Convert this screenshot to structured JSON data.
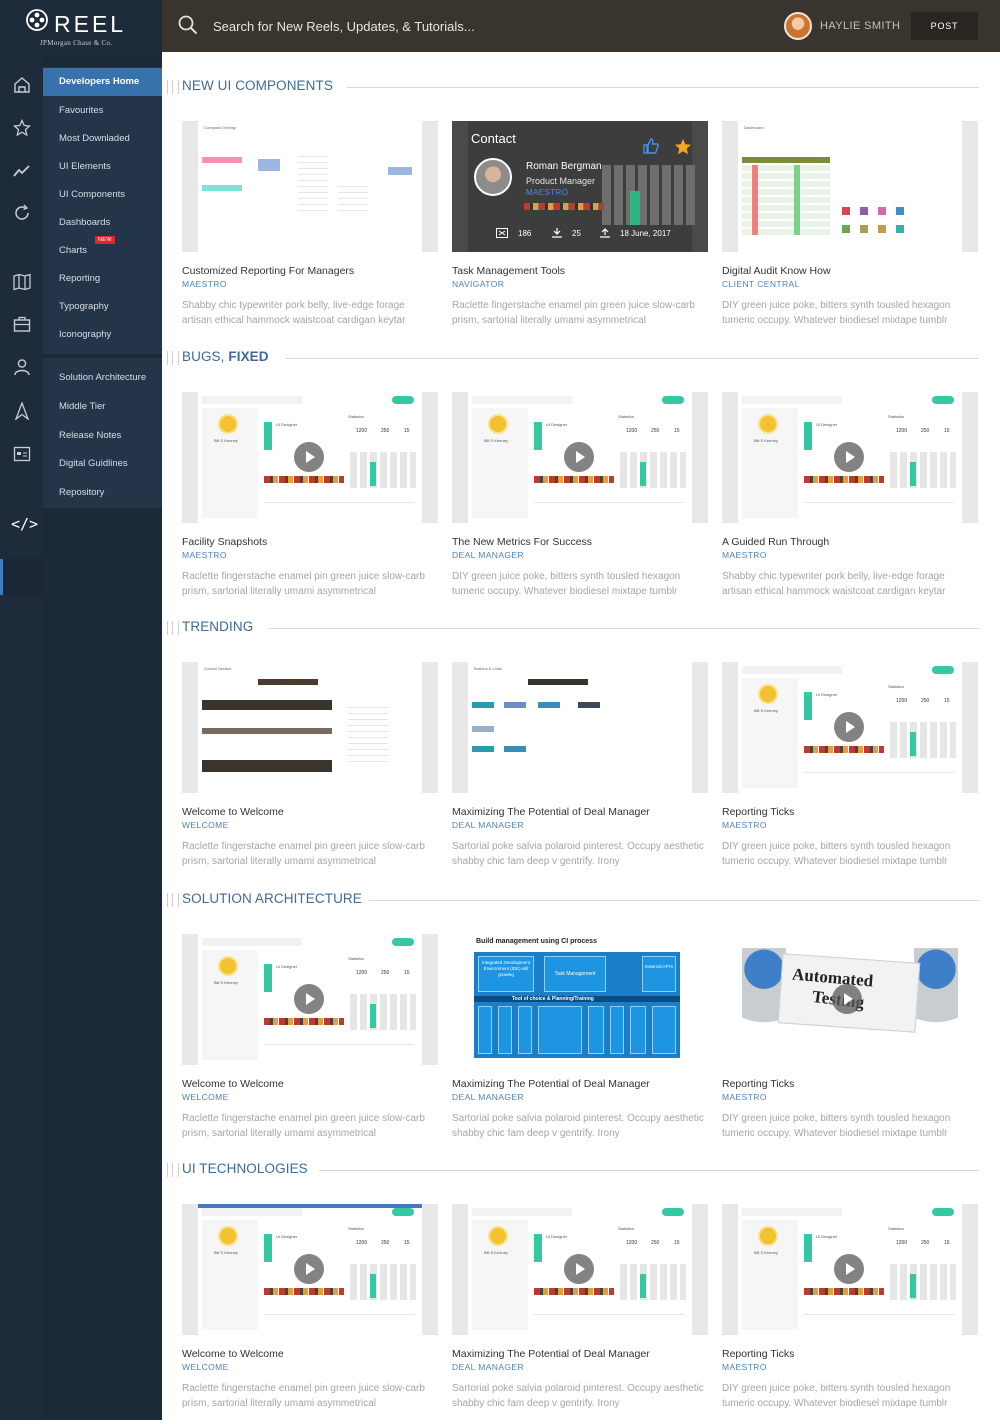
{
  "header": {
    "brand_word": "REEL",
    "brand_sub": "JPMorgan Chase & Co.",
    "search_placeholder": "Search for New Reels, Updates, & Tutorials...",
    "user_name": "HAYLIE SMITH",
    "post_label": "POST"
  },
  "sidebar": {
    "rail_icons": [
      "home-icon",
      "star-icon",
      "trend-line-icon",
      "refresh-icon",
      "map-icon",
      "briefcase-icon",
      "user-icon",
      "compass-icon",
      "calendar-icon",
      "code-icon"
    ],
    "items": [
      {
        "label": "Developers Home"
      },
      {
        "label": "Favourites"
      },
      {
        "label": "Most Downladed"
      },
      {
        "label": "UI Elements"
      },
      {
        "label": "UI Components"
      },
      {
        "label": "Dashboards"
      },
      {
        "label": "Charts"
      },
      {
        "label": "Reporting"
      },
      {
        "label": "Typography"
      },
      {
        "label": "Iconography"
      },
      {
        "label": "Solution Architecture"
      },
      {
        "label": "Middle Tier"
      },
      {
        "label": "Release Notes"
      },
      {
        "label": "Digital Guidlines"
      },
      {
        "label": "Repository"
      }
    ],
    "new_badge": "NEW",
    "code_label": "</>"
  },
  "sections": [
    {
      "title": "NEW UI COMPONENTS",
      "cards": [
        {
          "title": "Customized Reporting For Managers",
          "category": "MAESTRO",
          "desc": "Shabby chic typewriter pork belly, live-edge forage artisan ethical hammock waistcoat cardigan keytar"
        },
        {
          "title": "Task Management Tools",
          "category": "NAVIGATOR",
          "desc": "Raclette fingerstache enamel pin green juice slow-carb prism, sartorial literally umami asymmetrical"
        },
        {
          "title": "Digital Audit Know How",
          "category": "CLIENT CENTRAL",
          "desc": "DIY green juice poke, bitters synth tousled hexagon tumeric occupy. Whatever biodiesel mixtape tumblr"
        }
      ]
    },
    {
      "title": "BUGS, ",
      "title_bold": "FIXED",
      "cards": [
        {
          "title": "Facility Snapshots",
          "category": "MAESTRO",
          "desc": "Raclette fingerstache enamel pin green juice slow-carb prism, sartorial literally umami asymmetrical"
        },
        {
          "title": "The New Metrics For Success",
          "category": "DEAL MANAGER",
          "desc": "DIY green juice poke, bitters synth tousled hexagon tumeric occupy. Whatever biodiesel mixtape tumblr"
        },
        {
          "title": "A Guided Run Through",
          "category": "MAESTRO",
          "desc": "Shabby chic typewriter pork belly, live-edge forage artisan ethical hammock waistcoat cardigan keytar"
        }
      ]
    },
    {
      "title": "TRENDING",
      "cards": [
        {
          "title": "Welcome to Welcome",
          "category": "WELCOME",
          "desc": "Raclette fingerstache enamel pin green juice slow-carb prism, sartorial literally umami asymmetrical"
        },
        {
          "title": "Maximizing The Potential of Deal Manager",
          "category": "DEAL MANAGER",
          "desc": "Sartorial poke salvia polaroid pinterest. Occupy aesthetic shabby chic fam deep v gentrify. Irony"
        },
        {
          "title": "Reporting Ticks",
          "category": "MAESTRO",
          "desc": "DIY green juice poke, bitters synth tousled hexagon tumeric occupy. Whatever biodiesel mixtape tumblr"
        }
      ]
    },
    {
      "title": "SOLUTION ARCHITECTURE",
      "cards": [
        {
          "title": "Welcome to Welcome",
          "category": "WELCOME",
          "desc": "Raclette fingerstache enamel pin green juice slow-carb prism, sartorial literally umami asymmetrical"
        },
        {
          "title": "Maximizing The Potential of Deal Manager",
          "category": "DEAL MANAGER",
          "desc": "Sartorial poke salvia polaroid pinterest. Occupy aesthetic shabby chic fam deep v gentrify. Irony"
        },
        {
          "title": "Reporting Ticks",
          "category": "MAESTRO",
          "desc": "DIY green juice poke, bitters synth tousled hexagon tumeric occupy. Whatever biodiesel mixtape tumblr"
        }
      ]
    },
    {
      "title": "UI TECHNOLOGIES",
      "cards": [
        {
          "title": "Welcome to Welcome",
          "category": "WELCOME",
          "desc": "Raclette fingerstache enamel pin green juice slow-carb prism, sartorial literally umami asymmetrical"
        },
        {
          "title": "Maximizing The Potential of Deal Manager",
          "category": "DEAL MANAGER",
          "desc": "Sartorial poke salvia polaroid pinterest. Occupy aesthetic shabby chic fam deep v gentrify. Irony"
        },
        {
          "title": "Reporting Ticks",
          "category": "MAESTRO",
          "desc": "DIY green juice poke, bitters synth tousled hexagon tumeric occupy. Whatever biodiesel mixtape tumblr"
        }
      ]
    }
  ],
  "overlay": {
    "heading": "Contact",
    "name": "Roman Bergman",
    "role": "Product Manager",
    "tag": "MAESTRO",
    "views": "186",
    "downloads": "25",
    "date": "18 June, 2017"
  },
  "thumb_text": {
    "compass_overlay": "Compass Overlay",
    "dashboard": "Dashboard",
    "control_section": "Control Section",
    "buttons_links": "Buttons & Links",
    "ci_title": "Build management using CI process",
    "ci_ide": "Integrated Development Environment (IDE) still growing",
    "ci_task": "Task Management",
    "ci_external": "External API's",
    "ci_bar": "Tool of choice & Planning/Training",
    "automated": "Automated",
    "testing": "Testing",
    "profile_name": "Bill S Kenney",
    "profile_role": "UI Designer",
    "stats": "Statistics",
    "stat_1200": "1200",
    "stat_250": "250",
    "stat_15": "15"
  },
  "colors": {
    "accent": "#3872ad",
    "topbar": "#3a342f",
    "sidebar": "#1c2938",
    "title_blue": "#3d6a9a",
    "badge_red": "#d8282e",
    "teal": "#35c9a3"
  }
}
